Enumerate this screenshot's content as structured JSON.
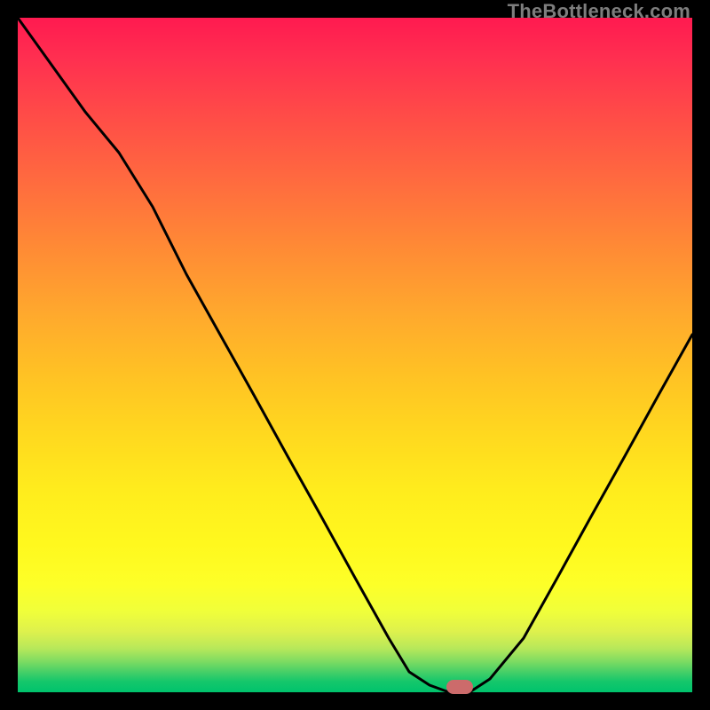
{
  "watermark": "TheBottleneck.com",
  "chart_data": {
    "type": "line",
    "title": "",
    "xlabel": "",
    "ylabel": "",
    "x": [
      0.0,
      0.05,
      0.1,
      0.15,
      0.2,
      0.25,
      0.3,
      0.35,
      0.4,
      0.45,
      0.5,
      0.55,
      0.58,
      0.61,
      0.64,
      0.67,
      0.7,
      0.75,
      0.8,
      0.85,
      0.9,
      0.95,
      1.0
    ],
    "y": [
      1.0,
      0.93,
      0.86,
      0.8,
      0.72,
      0.62,
      0.53,
      0.44,
      0.35,
      0.26,
      0.17,
      0.08,
      0.03,
      0.01,
      0.0,
      0.0,
      0.02,
      0.08,
      0.17,
      0.26,
      0.35,
      0.44,
      0.53
    ],
    "xlim": [
      0,
      1
    ],
    "ylim": [
      0,
      1
    ],
    "legend": false,
    "grid": false,
    "marker": {
      "x": 0.655,
      "y": 0.008
    },
    "gradient_colormap": "RdYlGn_r_vertical"
  }
}
